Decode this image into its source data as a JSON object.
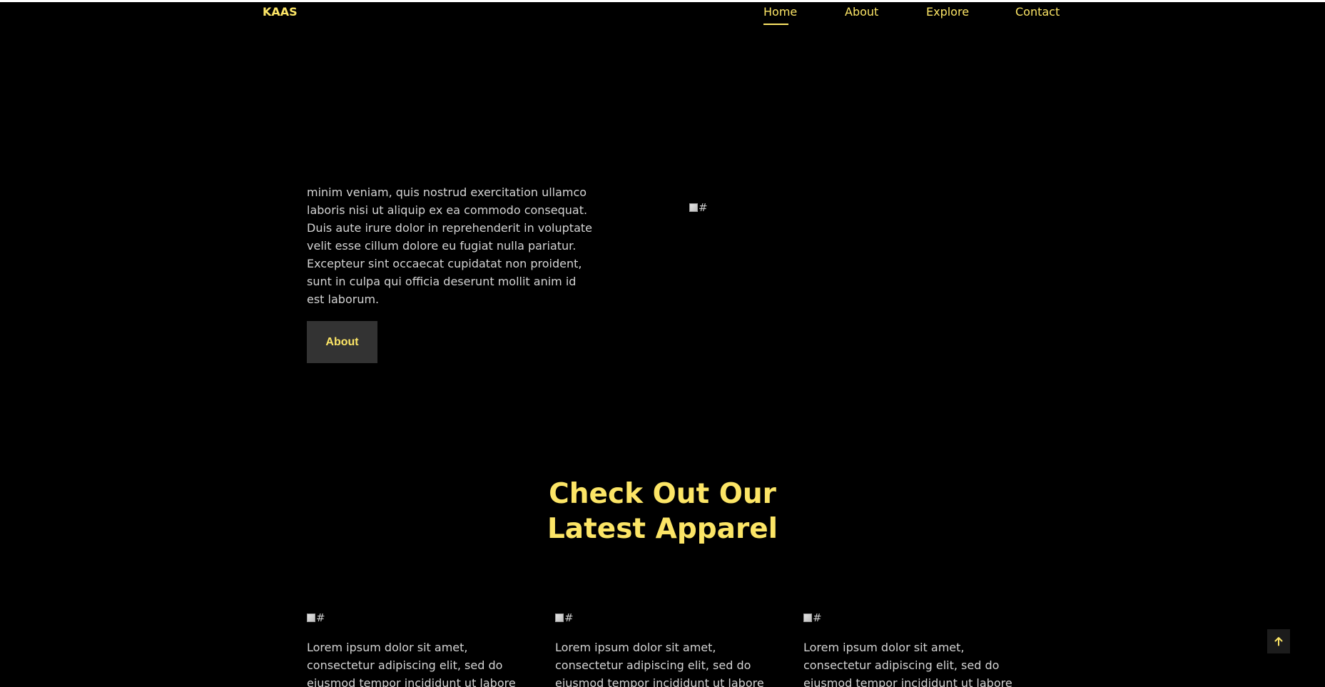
{
  "brand": "KAAS",
  "nav": {
    "items": [
      {
        "label": "Home",
        "active": true
      },
      {
        "label": "About",
        "active": false
      },
      {
        "label": "Explore",
        "active": false
      },
      {
        "label": "Contact",
        "active": false
      }
    ]
  },
  "hero": {
    "paragraph": "ut labore et dolore magna aliqua. Ut enim ad minim veniam, quis nostrud exercitation ullamco laboris nisi ut aliquip ex ea commodo consequat. Duis aute irure dolor in reprehenderit in voluptate velit esse cillum dolore eu fugiat nulla pariatur. Excepteur sint occaecat cupidatat non proident, sunt in culpa qui officia deserunt mollit anim id est laborum.",
    "button_label": "About",
    "image_alt": "#"
  },
  "apparel": {
    "title_line1": "Check Out Our",
    "title_line2": "Latest Apparel",
    "cards": [
      {
        "image_alt": "#",
        "text": "Lorem ipsum dolor sit amet, consectetur adipiscing elit, sed do eiusmod tempor incididunt ut labore"
      },
      {
        "image_alt": "#",
        "text": "Lorem ipsum dolor sit amet, consectetur adipiscing elit, sed do eiusmod tempor incididunt ut labore"
      },
      {
        "image_alt": "#",
        "text": "Lorem ipsum dolor sit amet, consectetur adipiscing elit, sed do eiusmod tempor incididunt ut labore"
      }
    ]
  },
  "scroll_top_icon": "arrow-up-icon",
  "colors": {
    "background": "#000000",
    "accent": "#fce566",
    "body_text": "#d4d4d4",
    "button_bg": "#333333"
  }
}
